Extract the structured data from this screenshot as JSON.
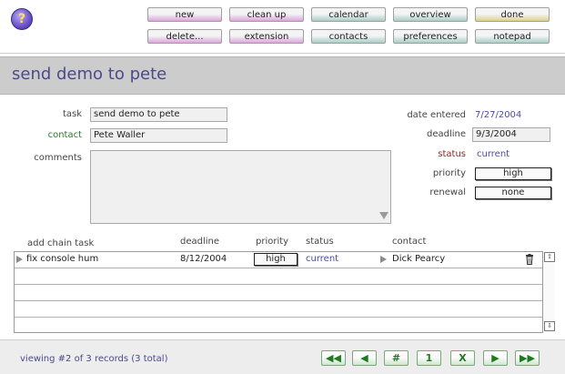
{
  "nav": {
    "row1": [
      "new",
      "clean up",
      "calendar",
      "overview",
      "done"
    ],
    "row2": [
      "delete...",
      "extension",
      "contacts",
      "preferences",
      "notepad"
    ]
  },
  "help_icon": "?",
  "title": "send demo to pete",
  "form": {
    "task_label": "task",
    "task_value": "send demo to pete",
    "contact_label": "contact",
    "contact_value": "Pete Waller",
    "comments_label": "comments",
    "date_entered_label": "date entered",
    "date_entered_value": "7/27/2004",
    "deadline_label": "deadline",
    "deadline_value": "9/3/2004",
    "status_label": "status",
    "status_value": "current",
    "priority_label": "priority",
    "priority_value": "high",
    "renewal_label": "renewal",
    "renewal_value": "none"
  },
  "chain": {
    "add_label": "add chain task",
    "headers": {
      "deadline": "deadline",
      "priority": "priority",
      "status": "status",
      "contact": "contact"
    },
    "rows": [
      {
        "task": "fix console hum",
        "deadline": "8/12/2004",
        "priority": "high",
        "status": "current",
        "contact": "Dick Pearcy"
      }
    ]
  },
  "footer": {
    "record_info": "viewing #2 of 3 records (3 total)",
    "pager": [
      "◀◀",
      "◀",
      "#",
      "1",
      "X",
      "▶",
      "▶▶"
    ]
  },
  "colors": {
    "accent": "#4a4a8a",
    "link": "#4a4aa8",
    "contact_label": "#2d7a2d",
    "status_label": "#9a2020",
    "pager": "#1e7a1e"
  }
}
